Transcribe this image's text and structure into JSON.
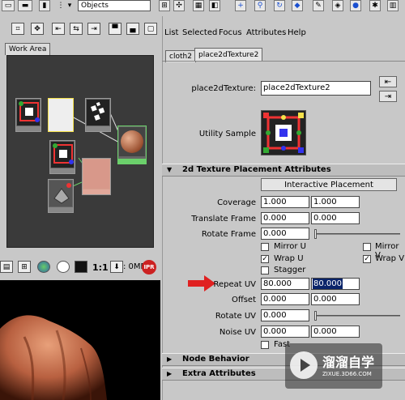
{
  "toolbar": {
    "objects_field": "Objects"
  },
  "left_panel": {
    "tab_work_area": "Work Area",
    "render_toolbar": {
      "zoom_label": "1:1",
      "memory_label": ": 0MB",
      "ipr_label": "IPR"
    }
  },
  "menu": {
    "items": [
      "List",
      "Selected",
      "Focus",
      "Attributes",
      "Help"
    ]
  },
  "tabs": [
    "cloth2",
    "place2dTexture2"
  ],
  "node": {
    "name_label": "place2dTexture:",
    "name_value": "place2dTexture2",
    "utility_sample_label": "Utility Sample"
  },
  "sections": {
    "placement": "2d Texture Placement Attributes",
    "node_behavior": "Node Behavior",
    "extra_attributes": "Extra Attributes"
  },
  "placement": {
    "interactive_button": "Interactive Placement",
    "coverage": {
      "label": "Coverage",
      "u": "1.000",
      "v": "1.000"
    },
    "translate_frame": {
      "label": "Translate Frame",
      "u": "0.000",
      "v": "0.000"
    },
    "rotate_frame": {
      "label": "Rotate Frame",
      "value": "0.000",
      "slider_fraction": 0.0
    },
    "mirror_u": {
      "label": "Mirror U",
      "checked": false
    },
    "mirror_v": {
      "label": "Mirror V",
      "checked": false
    },
    "wrap_u": {
      "label": "Wrap U",
      "checked": true
    },
    "wrap_v": {
      "label": "Wrap V",
      "checked": true
    },
    "stagger": {
      "label": "Stagger",
      "checked": false
    },
    "repeat_uv": {
      "label": "Repeat UV",
      "u": "80.000",
      "v": "80.000"
    },
    "offset": {
      "label": "Offset",
      "u": "0.000",
      "v": "0.000"
    },
    "rotate_uv": {
      "label": "Rotate UV",
      "value": "0.000",
      "slider_fraction": 0.0
    },
    "noise_uv": {
      "label": "Noise UV",
      "u": "0.000",
      "v": "0.000"
    },
    "fast": {
      "label": "Fast",
      "checked": false
    }
  },
  "watermark": {
    "title": "溜溜自学",
    "subtitle": "ZIXUE.3D66.COM"
  },
  "colors": {
    "arrow": "#e02020",
    "selection": "#0a246a",
    "panel": "#c8c8c8",
    "hypershade_bg": "#3a3a3a"
  }
}
